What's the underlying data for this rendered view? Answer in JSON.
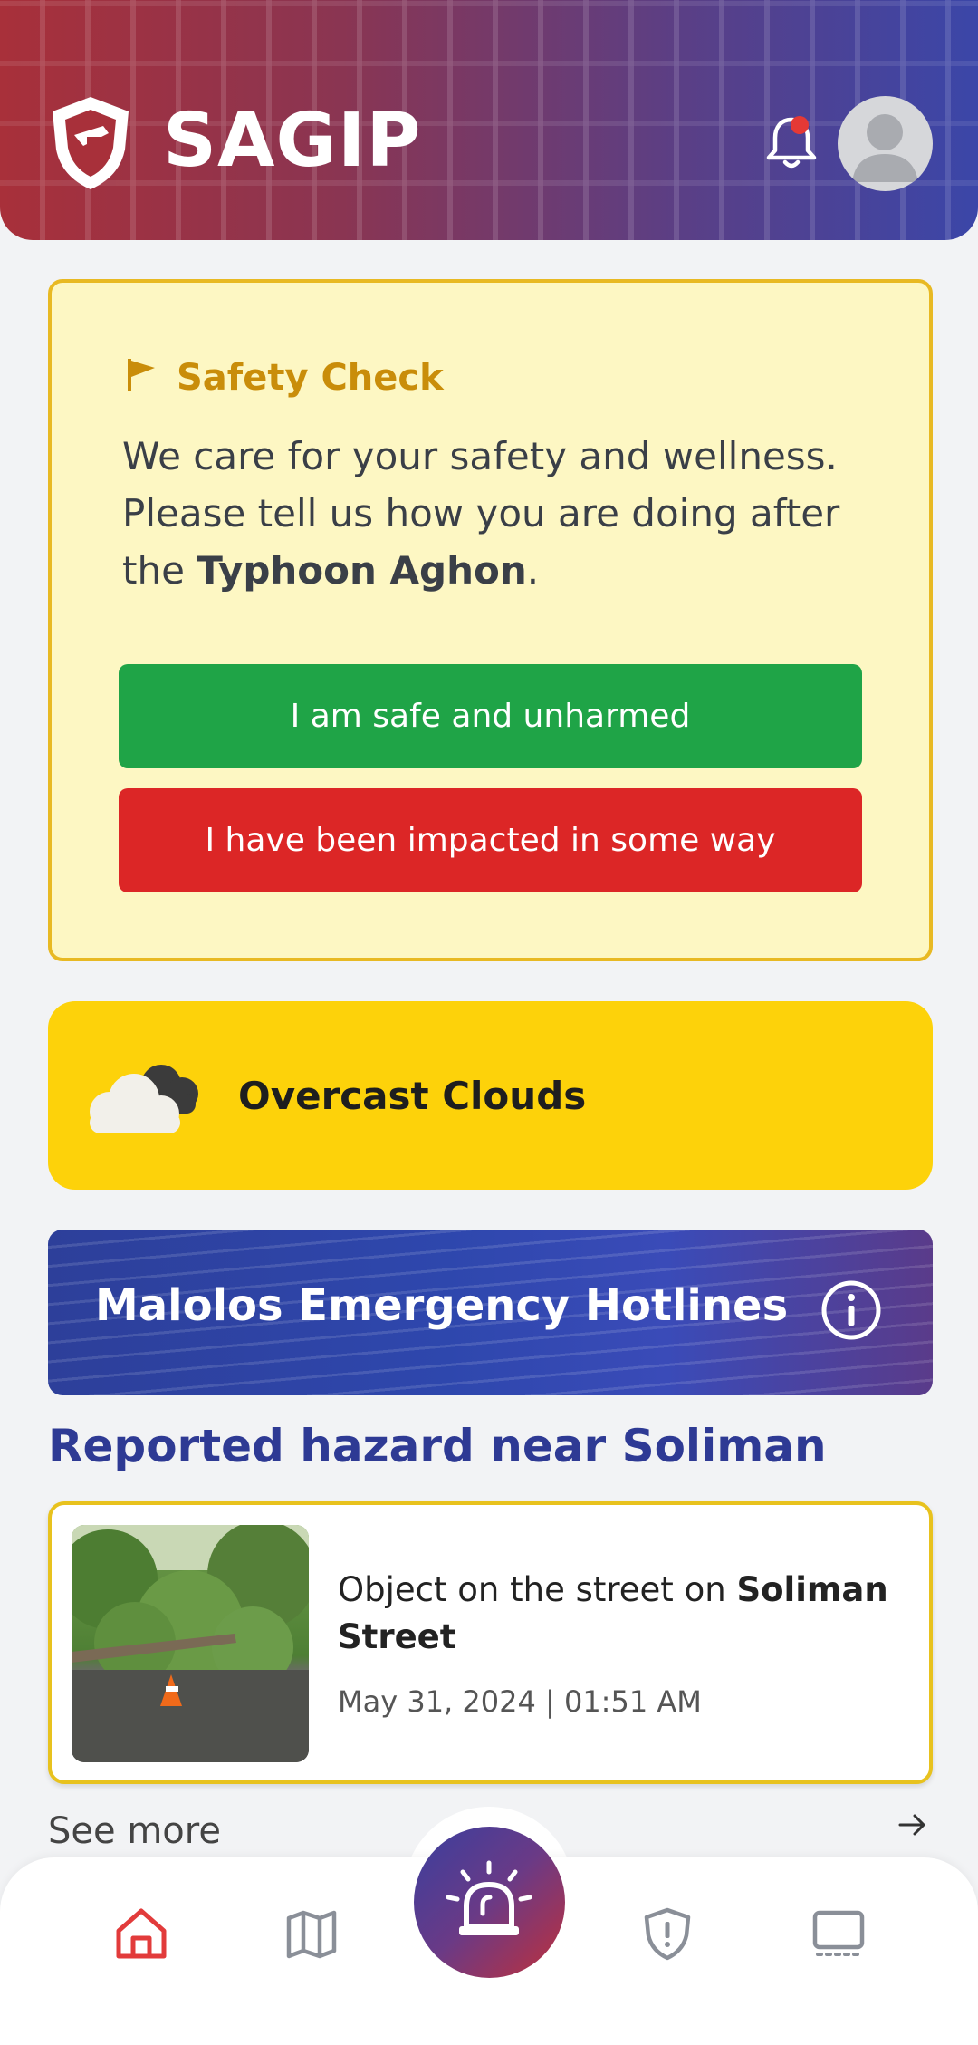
{
  "header": {
    "app_name": "SAGIP"
  },
  "safety_check": {
    "title": "Safety Check",
    "text_line1": "We care for your safety and wellness.",
    "text_line2": "Please tell us how you are doing after",
    "text_prefix": "the ",
    "typhoon_name": "Typhoon Aghon",
    "text_suffix": ".",
    "safe_button": "I am safe and unharmed",
    "impacted_button": "I have been impacted in some way",
    "colors": {
      "safe": "#1fa447",
      "impacted": "#dc2626"
    }
  },
  "weather": {
    "label": "Overcast Clouds",
    "icon": "cloud-icon"
  },
  "hotlines": {
    "title": "Malolos Emergency Hotlines",
    "icon": "info-icon"
  },
  "hazard": {
    "heading": "Reported hazard near Soliman",
    "description_prefix": "Object on the street on ",
    "street": "Soliman Street",
    "datetime": "May 31, 2024 | 01:51 AM"
  },
  "see_more": {
    "label": "See more",
    "icon": "arrow-right-icon"
  },
  "bottom_nav": {
    "items": [
      {
        "icon": "home-icon",
        "active": true
      },
      {
        "icon": "map-icon",
        "active": false
      },
      {
        "icon": "siren-icon",
        "active": false
      },
      {
        "icon": "shield-alert-icon",
        "active": false
      },
      {
        "icon": "monitor-icon",
        "active": false
      }
    ]
  }
}
